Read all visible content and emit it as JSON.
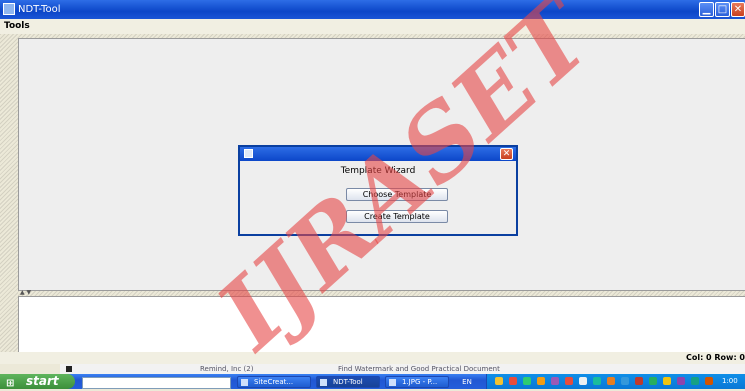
{
  "window": {
    "title": "NDT-Tool",
    "controls": {
      "minimize": "▁",
      "maximize": "□",
      "close": "✕"
    }
  },
  "menubar": {
    "items": [
      {
        "label": "Tools"
      }
    ]
  },
  "dialog": {
    "close": "✕",
    "heading": "Template Wizard",
    "buttons": {
      "choose": "Choose Template",
      "create": "Create Template"
    }
  },
  "status_bar": {
    "position": "Col: 0 Row: 0"
  },
  "split_divider": {
    "arrows": "▲ ▼"
  },
  "watermark": {
    "text": "IJRASET"
  },
  "background_strip": {
    "left_text": "Remind, Inc (2)",
    "right_text": "Find Watermark and Good Practical Document"
  },
  "taskbar": {
    "start_label": "start",
    "tasks": [
      {
        "label": "SiteCreat...",
        "active": false
      },
      {
        "label": "NDT-Tool",
        "active": true
      },
      {
        "label": "1.JPG - P...",
        "active": false
      }
    ],
    "language": "EN",
    "clock": "1:00"
  },
  "colors": {
    "titlebar": "#0c46c8",
    "watermark": "#e64646",
    "start_button": "#3c8f3a",
    "tray": "#0f8fe8"
  },
  "icons": {
    "app": "app-icon",
    "dialog": "java-cup-icon",
    "start": "windows-flag-icon",
    "tray": [
      "speaker-icon",
      "network-icon",
      "shield-icon",
      "chat-icon",
      "update-icon",
      "antivirus-icon",
      "printer-icon",
      "clock-icon"
    ]
  }
}
